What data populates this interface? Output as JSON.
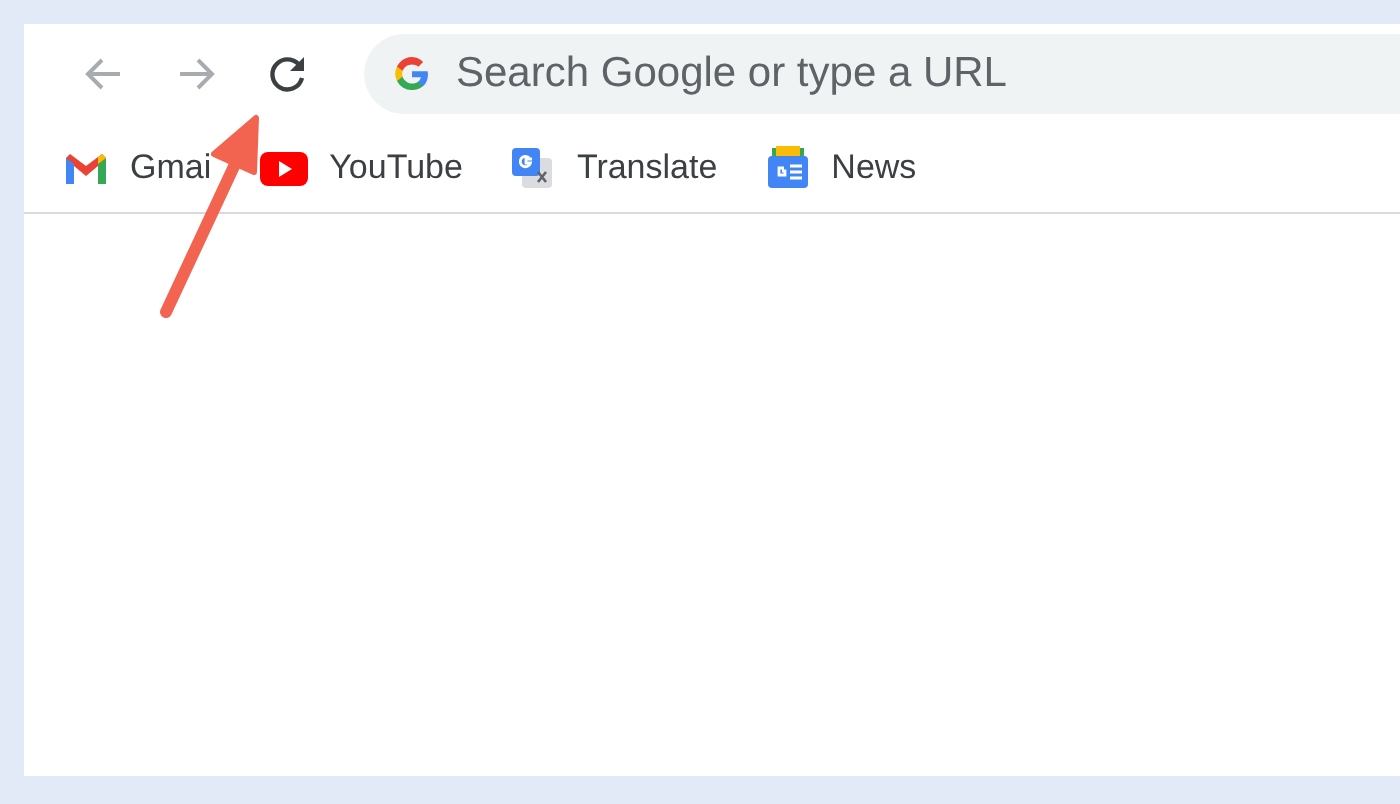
{
  "toolbar": {
    "buttons": [
      {
        "kind": "back",
        "disabled": true
      },
      {
        "kind": "forward",
        "disabled": true
      },
      {
        "kind": "reload",
        "disabled": false
      }
    ],
    "omnibox": {
      "placeholder": "Search Google or type a URL"
    }
  },
  "bookmarks": [
    {
      "kind": "gmail",
      "label": "Gmai"
    },
    {
      "kind": "youtube",
      "label": "YouTube"
    },
    {
      "kind": "translate",
      "label": "Translate"
    },
    {
      "kind": "news",
      "label": "News"
    }
  ]
}
